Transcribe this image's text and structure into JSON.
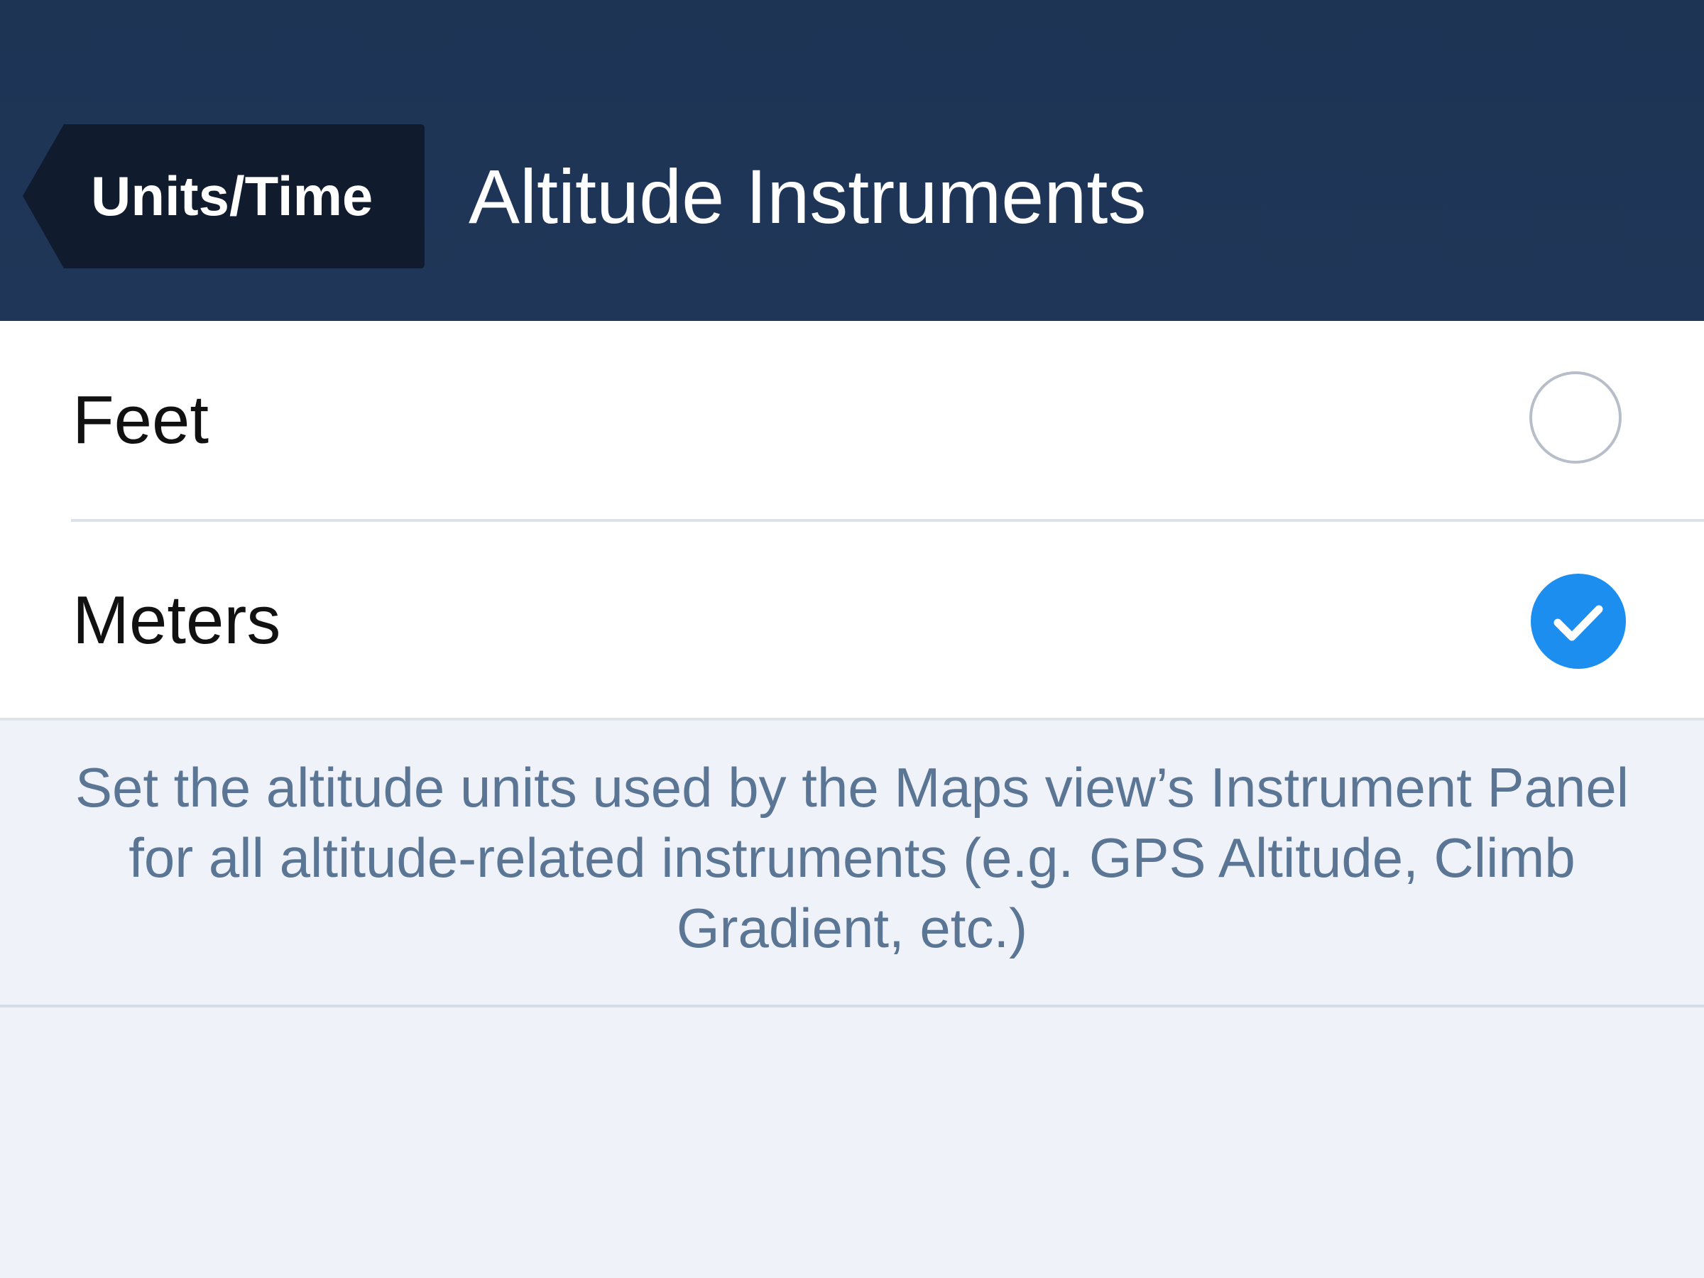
{
  "nav": {
    "back_label": "Units/Time",
    "title": "Altitude Instruments",
    "background_color": "#1f3658",
    "back_button_color": "#101b2d"
  },
  "options": [
    {
      "label": "Feet",
      "selected": false
    },
    {
      "label": "Meters",
      "selected": true
    }
  ],
  "description": "Set the altitude units used by the Maps view’s Instrument Panel for all altitude-related instruments (e.g. GPS Altitude, Climb Gradient, etc.)",
  "colors": {
    "accent": "#1c8ef0",
    "description_text": "#5a7694",
    "page_background": "#eff2f9"
  },
  "icons": {
    "back": "back-arrow-icon",
    "check": "checkmark-icon"
  }
}
